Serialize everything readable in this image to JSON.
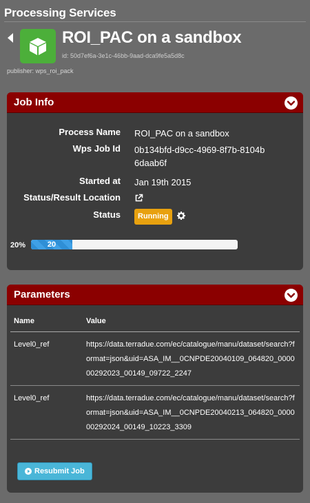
{
  "top": {
    "title": "Processing Services"
  },
  "header": {
    "title": "ROI_PAC on a sandbox",
    "id_text": "id: 50d7ef6a-3e1c-46bb-9aad-dca9fe5a5d8c",
    "publisher_text": "publisher: wps_roi_pack",
    "icon_color": "#4caf3a"
  },
  "job_info": {
    "title": "Job Info",
    "rows": {
      "process_name": {
        "label": "Process Name",
        "value": "ROI_PAC on a sandbox"
      },
      "wps_job_id": {
        "label": "Wps Job Id",
        "value": "0b134bfd-d9cc-4969-8f7b-8104b6daab6f"
      },
      "started_at": {
        "label": "Started at",
        "value": "Jan 19th 2015"
      },
      "status_location": {
        "label": "Status/Result Location"
      },
      "status": {
        "label": "Status",
        "value": "Running"
      }
    },
    "progress": {
      "label": "20%",
      "bar_text": "20",
      "fraction": 0.2
    }
  },
  "parameters": {
    "title": "Parameters",
    "columns": [
      "Name",
      "Value"
    ],
    "rows": [
      {
        "name": "Level0_ref",
        "value": "https://data.terradue.com/ec/catalogue/manu/dataset/search?format=json&uid=ASA_IM__0CNPDE20040109_064820_000000292023_00149_09722_2247"
      },
      {
        "name": "Level0_ref",
        "value": "https://data.terradue.com/ec/catalogue/manu/dataset/search?format=json&uid=ASA_IM__0CNPDE20040213_064820_000000292024_00149_10223_3309"
      }
    ],
    "resubmit_label": "Resubmit Job"
  },
  "colors": {
    "panel_header": "#8b0000",
    "badge": "#e8a10f",
    "progress": "#2f8fd6",
    "button": "#4ab6d8"
  }
}
